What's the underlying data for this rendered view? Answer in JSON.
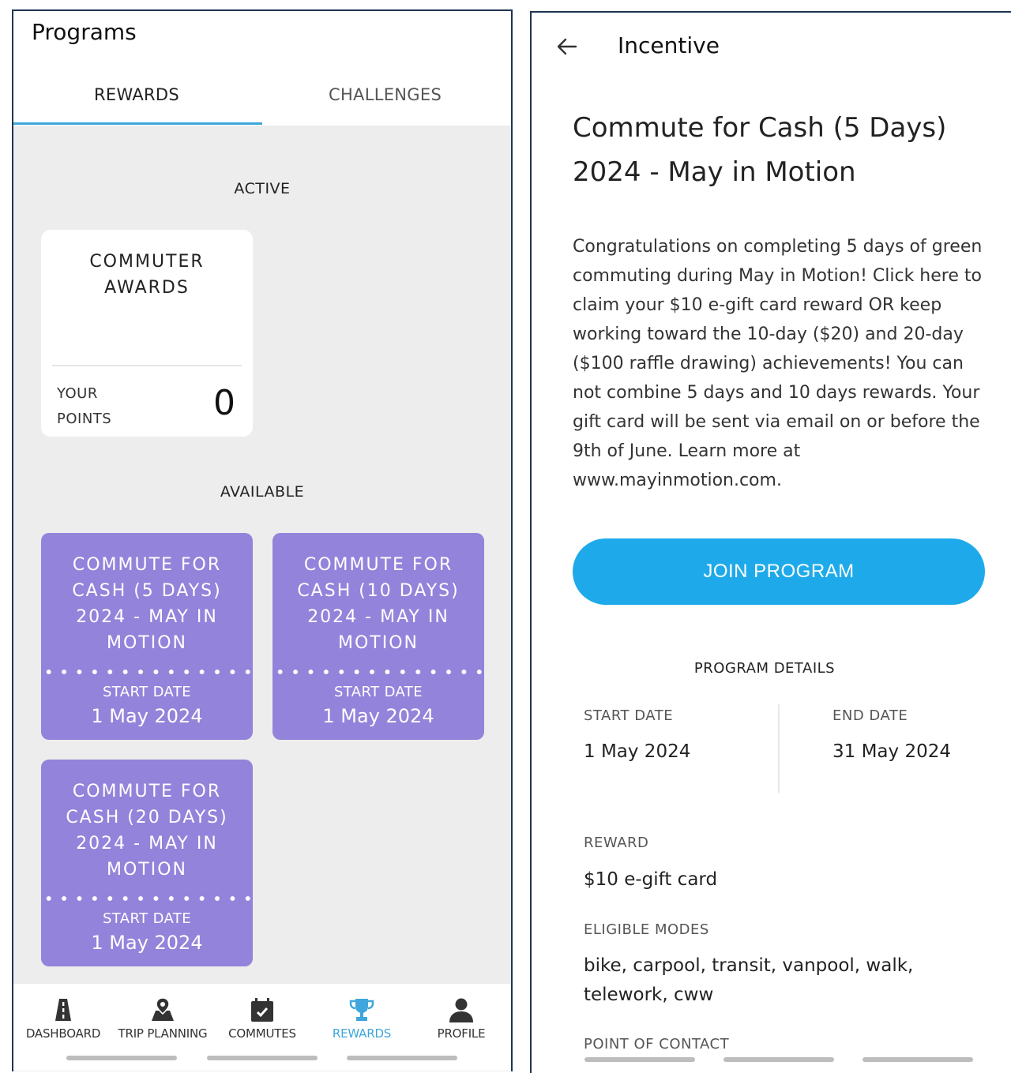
{
  "left": {
    "title": "Programs",
    "tabs": [
      {
        "label": "REWARDS",
        "active": true
      },
      {
        "label": "CHALLENGES",
        "active": false
      }
    ],
    "active_section": "ACTIVE",
    "active_card": {
      "title_line1": "COMMUTER",
      "title_line2": "AWARDS",
      "points_label_line1": "YOUR",
      "points_label_line2": "POINTS",
      "points": "0"
    },
    "available_section": "AVAILABLE",
    "cards": [
      {
        "title": [
          "COMMUTE FOR",
          "CASH (5 DAYS)",
          "2024 - MAY IN",
          "MOTION"
        ],
        "start_label": "START DATE",
        "start_date": "1 May 2024"
      },
      {
        "title": [
          "COMMUTE FOR",
          "CASH (10 DAYS)",
          "2024 - MAY IN",
          "MOTION"
        ],
        "start_label": "START DATE",
        "start_date": "1 May 2024"
      },
      {
        "title": [
          "COMMUTE FOR",
          "CASH (20 DAYS)",
          "2024 - MAY IN",
          "MOTION"
        ],
        "start_label": "START DATE",
        "start_date": "1 May 2024"
      }
    ],
    "nav": [
      {
        "label": "DASHBOARD",
        "icon": "road-icon",
        "active": false
      },
      {
        "label": "TRIP PLANNING",
        "icon": "map-pin-icon",
        "active": false
      },
      {
        "label": "COMMUTES",
        "icon": "calendar-check-icon",
        "active": false
      },
      {
        "label": "REWARDS",
        "icon": "trophy-icon",
        "active": true
      },
      {
        "label": "PROFILE",
        "icon": "person-icon",
        "active": false
      }
    ],
    "colors": {
      "card_purple": "#9483da",
      "accent_blue": "#3ea6dc",
      "background": "#ededed"
    }
  },
  "right": {
    "title": "Incentive",
    "heading_line1": "Commute for Cash (5 Days)",
    "heading_line2": "2024 - May in Motion",
    "description": "Congratulations on completing 5 days of green commuting during May in Motion! Click here to claim your $10 e-gift card reward OR keep working toward the 10-day ($20) and 20-day ($100 raffle drawing) achievements! You can not combine 5 days and 10 days rewards. Your gift card will be sent via email on or before the 9th of June. Learn more at www.mayinmotion.com.",
    "join_button": "JOIN PROGRAM",
    "details_label": "PROGRAM DETAILS",
    "start_label": "START DATE",
    "start_date": "1 May 2024",
    "end_label": "END DATE",
    "end_date": "31 May 2024",
    "reward_label": "REWARD",
    "reward_value": "$10 e-gift card",
    "modes_label": "ELIGIBLE MODES",
    "modes_line1": "bike, carpool, transit, vanpool, walk,",
    "modes_line2": "telework, cww",
    "contact_label": "POINT OF CONTACT",
    "colors": {
      "button_blue": "#1eaaea"
    }
  }
}
